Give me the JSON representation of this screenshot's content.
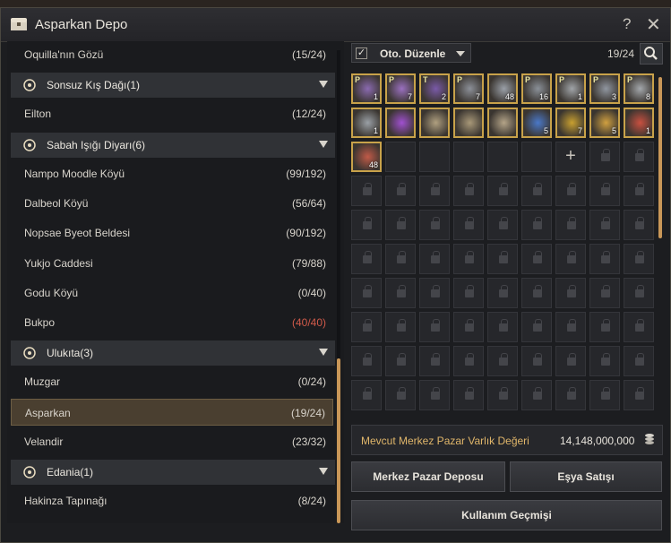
{
  "window": {
    "title": "Asparkan Depo",
    "help": "?",
    "close": "✕"
  },
  "list": {
    "rows": [
      {
        "type": "town",
        "name": "Oquilla'nın Gözü",
        "count": "(15/24)"
      },
      {
        "type": "region",
        "name": "Sonsuz Kış Dağı(1)",
        "icon": "sun-icon"
      },
      {
        "type": "town",
        "name": "Eilton",
        "count": "(12/24)"
      },
      {
        "type": "region",
        "name": "Sabah Işığı Diyarı(6)",
        "icon": "seal-icon"
      },
      {
        "type": "town",
        "name": "Nampo Moodle Köyü",
        "count": "(99/192)"
      },
      {
        "type": "town",
        "name": "Dalbeol Köyü",
        "count": "(56/64)"
      },
      {
        "type": "town",
        "name": "Nopsae Byeot Beldesi",
        "count": "(90/192)"
      },
      {
        "type": "town",
        "name": "Yukjo Caddesi",
        "count": "(79/88)"
      },
      {
        "type": "town",
        "name": "Godu Köyü",
        "count": "(0/40)"
      },
      {
        "type": "town",
        "name": "Bukpo",
        "count": "(40/40)",
        "full": true
      },
      {
        "type": "region",
        "name": "Ulukıta(3)",
        "icon": "compass-star-icon"
      },
      {
        "type": "town",
        "name": "Muzgar",
        "count": "(0/24)"
      },
      {
        "type": "town",
        "name": "Asparkan",
        "count": "(19/24)",
        "selected": true
      },
      {
        "type": "town",
        "name": "Velandir",
        "count": "(23/32)"
      },
      {
        "type": "region",
        "name": "Edania(1)",
        "icon": "emblem-icon"
      },
      {
        "type": "town",
        "name": "Hakinza Tapınağı",
        "count": "(8/24)"
      }
    ]
  },
  "storage": {
    "auto_sort_label": "Oto. Düzenle",
    "auto_sort_checked": "✓",
    "slot_count": "19/24",
    "items": [
      {
        "icon": "purple-scroll-icon",
        "tag": "P",
        "qty": "1",
        "color": "#8a6ab0"
      },
      {
        "icon": "purple-scroll-icon",
        "tag": "P",
        "qty": "7",
        "color": "#9a70c0"
      },
      {
        "icon": "purple-scroll-icon",
        "tag": "T",
        "qty": "2",
        "color": "#7a5aa8"
      },
      {
        "icon": "feather-icon",
        "tag": "P",
        "qty": "7",
        "color": "#8c9098"
      },
      {
        "icon": "feather-icon",
        "tag": "",
        "qty": "48",
        "color": "#9aa0a8"
      },
      {
        "icon": "feather-icon",
        "tag": "P",
        "qty": "16",
        "color": "#8a9098"
      },
      {
        "icon": "coral-icon",
        "tag": "P",
        "qty": "1",
        "color": "#a0a4a8"
      },
      {
        "icon": "feather-icon",
        "tag": "P",
        "qty": "3",
        "color": "#9096a0"
      },
      {
        "icon": "coral-icon",
        "tag": "P",
        "qty": "8",
        "color": "#a4a8ac"
      },
      {
        "icon": "coral-icon",
        "tag": "",
        "qty": "1",
        "color": "#9aa0a6"
      },
      {
        "icon": "magic-book-icon",
        "tag": "",
        "qty": "",
        "color": "#a050d0"
      },
      {
        "icon": "scroll-case-icon",
        "tag": "",
        "qty": "",
        "color": "#b0a080"
      },
      {
        "icon": "scroll-case-icon",
        "tag": "",
        "qty": "",
        "color": "#a89878"
      },
      {
        "icon": "scroll-case-icon",
        "tag": "",
        "qty": "",
        "color": "#b4a488"
      },
      {
        "icon": "blue-crystal-icon",
        "tag": "",
        "qty": "5",
        "color": "#4a78c8"
      },
      {
        "icon": "golden-book-icon",
        "tag": "",
        "qty": "7",
        "color": "#c8a030"
      },
      {
        "icon": "gold-ticket-icon",
        "tag": "",
        "qty": "5",
        "color": "#d0a040"
      },
      {
        "icon": "red-bundle-icon",
        "tag": "",
        "qty": "1",
        "color": "#c85040"
      },
      {
        "icon": "red-bundle-icon",
        "tag": "",
        "qty": "48",
        "color": "#c05a48"
      }
    ],
    "add_slot": "+",
    "market_value_label": "Mevcut Merkez Pazar Varlık Değeri",
    "market_value": "14,148,000,000",
    "btn_market": "Merkez Pazar Deposu",
    "btn_sell": "Eşya Satışı",
    "btn_history": "Kullanım Geçmişi"
  },
  "colors": {
    "accent": "#c99758",
    "item_border": "#c8a24a",
    "full_count": "#d05a4a"
  }
}
